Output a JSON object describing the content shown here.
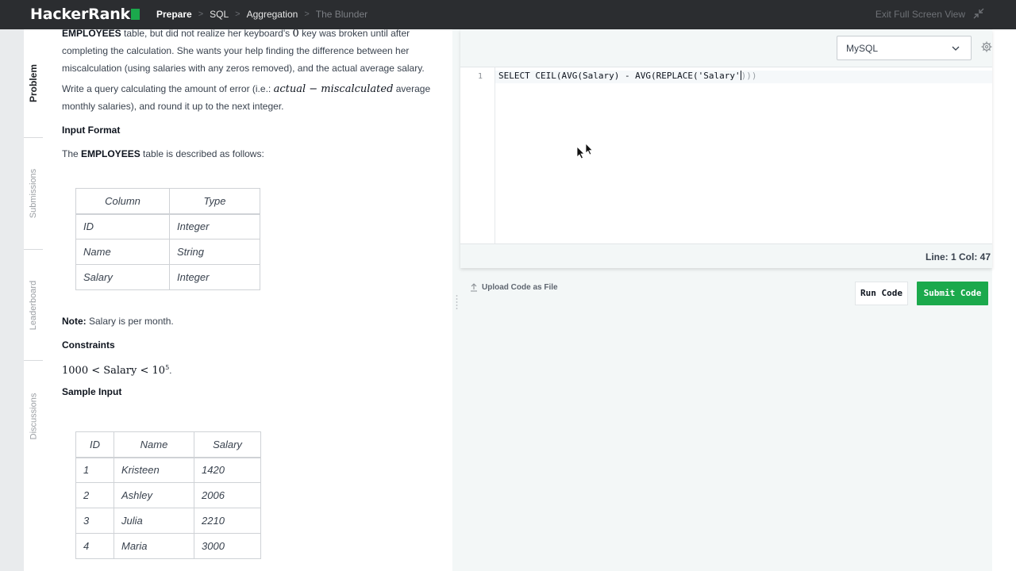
{
  "topbar": {
    "logo": "HackerRank",
    "breadcrumbs": [
      "Prepare",
      "SQL",
      "Aggregation",
      "The Blunder"
    ],
    "exit_fullscreen": "Exit Full Screen View"
  },
  "vtabs": [
    "Problem",
    "Submissions",
    "Leaderboard",
    "Discussions"
  ],
  "problem": {
    "para1_a": "EMPLOYEES",
    "para1_b": " table, but did not realize her keyboard's ",
    "para1_zero": "0",
    "para1_c": " key was broken until after",
    "para2": "completing the calculation. She wants your help finding the difference between her",
    "para3": "miscalculation (using salaries with any zeros removed), and the actual average salary.",
    "para4_a": "Write a query calculating the amount of error (i.e.: ",
    "para4_math": "actual − miscalculated",
    "para4_b": " average",
    "para5": "monthly salaries), and round it up to the next integer.",
    "input_format": "Input Format",
    "table_desc_a": "The ",
    "table_desc_b": "EMPLOYEES",
    "table_desc_c": " table is described as follows:",
    "schema_headers": [
      "Column",
      "Type"
    ],
    "schema_rows": [
      [
        "ID",
        "Integer"
      ],
      [
        "Name",
        "String"
      ],
      [
        "Salary",
        "Integer"
      ]
    ],
    "note_label": "Note:",
    "note_text": " Salary is per month.",
    "constraints": "Constraints",
    "constraint_math_a": "1000 < Salary < 10",
    "constraint_math_exp": "5",
    "constraint_math_end": ".",
    "sample_input": "Sample Input",
    "sample_headers": [
      "ID",
      "Name",
      "Salary"
    ],
    "sample_rows": [
      [
        "1",
        "Kristeen",
        "1420"
      ],
      [
        "2",
        "Ashley",
        "2006"
      ],
      [
        "3",
        "Julia",
        "2210"
      ],
      [
        "4",
        "Maria",
        "3000"
      ]
    ]
  },
  "editor": {
    "language": "MySQL",
    "line_number": "1",
    "code": "SELECT CEIL(AVG(Salary) - AVG(REPLACE('Salary'",
    "code_tail": ")))",
    "status": "Line: 1 Col: 47"
  },
  "actions": {
    "upload": "Upload Code as File",
    "run": "Run Code",
    "submit": "Submit Code"
  },
  "colors": {
    "brand_green": "#1ba94c",
    "topbar": "#2b2d30"
  }
}
